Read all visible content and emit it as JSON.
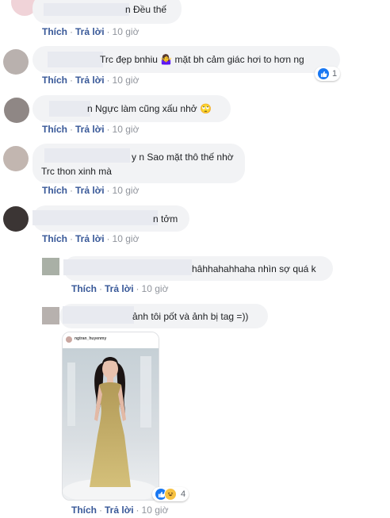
{
  "actions": {
    "like": "Thích",
    "reply": "Trả lời",
    "dot": "·"
  },
  "comments": [
    {
      "text": "n Đều thế",
      "time": "10 giờ"
    },
    {
      "text": "Trc đẹp bnhiu 🤷‍♀️ mặt bh cảm giác hơi to hơn ng",
      "time": "10 giờ",
      "reaction_count": "1"
    },
    {
      "text": "n Ngực làm cũng xấu nhở 🙄",
      "time": "10 giờ"
    },
    {
      "line1": "y n Sao mặt thô thế nhờ",
      "line2": "Trc thon xinh mà",
      "time": "10 giờ"
    },
    {
      "text": "n tởm",
      "time": "10 giờ"
    }
  ],
  "replies": [
    {
      "text": "hâhhahahhaha nhìn sợ quá k",
      "time": "10 giờ"
    },
    {
      "text": "ảnh tôi pốt và ảnh bị tag =))",
      "time": "10 giờ",
      "photo_username": "ngtran_huyenmy",
      "reaction_count": "4"
    }
  ],
  "colors": {
    "link": "#385898",
    "bubble": "#f2f3f5",
    "time": "#90949c",
    "like_blue": "#1877f2"
  },
  "icons": {
    "like": "like-icon",
    "haha": "haha-icon",
    "eyeroll": "eye-roll-emoji",
    "shrug": "shrug-emoji"
  }
}
